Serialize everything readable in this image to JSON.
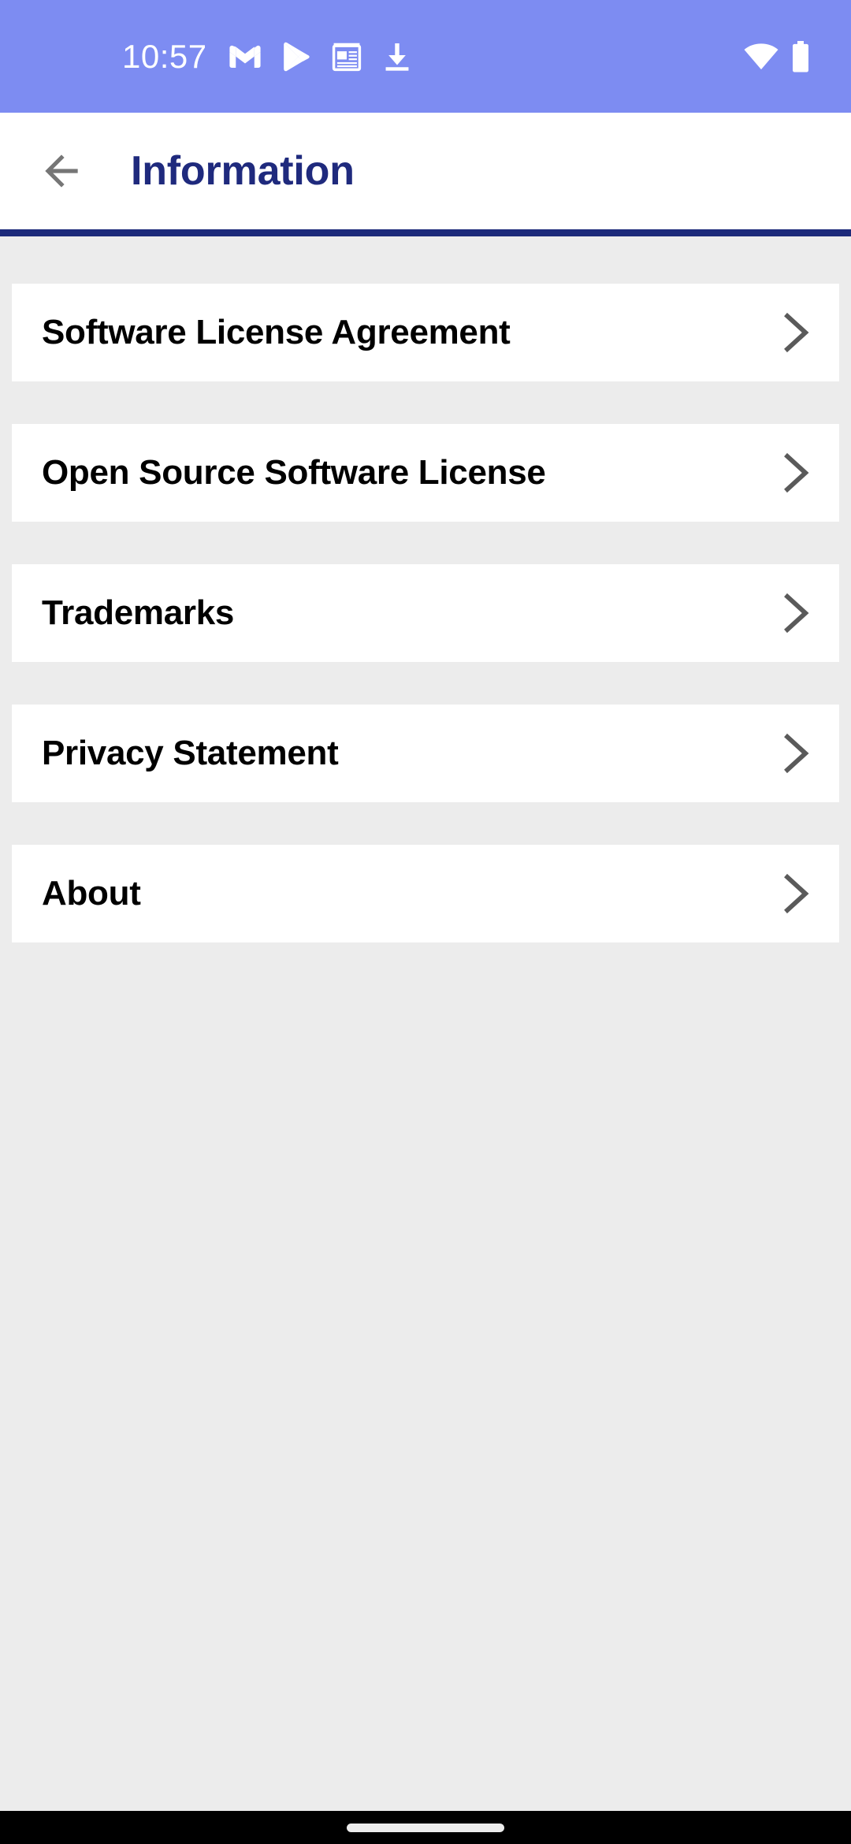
{
  "status_bar": {
    "time": "10:57",
    "background_color": "#7d8cf2",
    "left_icons": [
      "gmail-icon",
      "google-play-icon",
      "news-icon",
      "download-icon"
    ],
    "right_icons": [
      "wifi-icon",
      "battery-icon"
    ]
  },
  "app_bar": {
    "back_label": "back-arrow",
    "title": "Information",
    "title_color": "#1f2a7d",
    "underline_color": "#1c2a7a"
  },
  "list": {
    "items": [
      {
        "label": "Software License Agreement",
        "chevron": "chevron-right-icon"
      },
      {
        "label": "Open Source Software License",
        "chevron": "chevron-right-icon"
      },
      {
        "label": "Trademarks",
        "chevron": "chevron-right-icon"
      },
      {
        "label": "Privacy Statement",
        "chevron": "chevron-right-icon"
      },
      {
        "label": "About",
        "chevron": "chevron-right-icon"
      }
    ]
  },
  "nav_bar": {
    "gesture_pill": "home-gesture-pill"
  }
}
